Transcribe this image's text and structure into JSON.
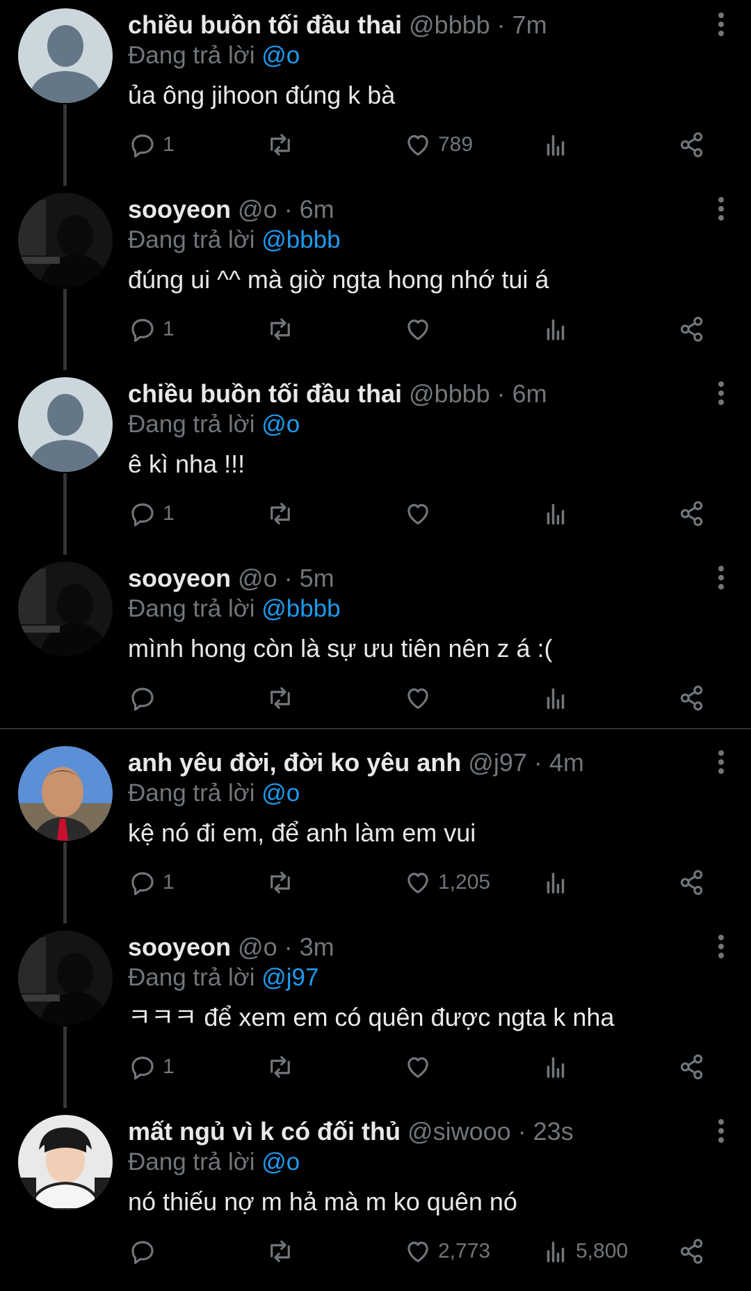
{
  "colors": {
    "background": "#000000",
    "text": "#e7e9ea",
    "muted": "#71767b",
    "link": "#1d9bf0"
  },
  "icons": {
    "reply": "reply-icon",
    "retweet": "retweet-icon",
    "like": "heart-icon",
    "views": "views-icon",
    "share": "share-icon",
    "more": "more-vertical-icon"
  },
  "tweets": [
    {
      "name": "chiều buồn tối đầu thai",
      "handle": "@bbbb",
      "time": "· 7m",
      "replying_label": "Đang trả lời",
      "replying_to": "@o",
      "text": "ủa ông jihoon đúng k bà",
      "replies": "1",
      "retweets": "",
      "likes": "789",
      "views": "",
      "avatar": "default"
    },
    {
      "name": "sooyeon",
      "handle": "@o",
      "time": "· 6m",
      "replying_label": "Đang trả lời",
      "replying_to": "@bbbb",
      "text": "đúng ui ^^ mà giờ ngta hong nhớ tui á",
      "replies": "1",
      "retweets": "",
      "likes": "",
      "views": "",
      "avatar": "dark"
    },
    {
      "name": "chiều buồn tối đầu thai",
      "handle": "@bbbb",
      "time": "· 6m",
      "replying_label": "Đang trả lời",
      "replying_to": "@o",
      "text": "ê kì nha !!!",
      "replies": "1",
      "retweets": "",
      "likes": "",
      "views": "",
      "avatar": "default"
    },
    {
      "name": "sooyeon",
      "handle": "@o",
      "time": "· 5m",
      "replying_label": "Đang trả lời",
      "replying_to": "@bbbb",
      "text": "mình hong còn là sự ưu tiên nên z á :(",
      "replies": "",
      "retweets": "",
      "likes": "",
      "views": "",
      "avatar": "dark"
    },
    {
      "name": "anh yêu đời, đời ko yêu anh",
      "handle": "@j97",
      "time": "· 4m",
      "replying_label": "Đang trả lời",
      "replying_to": "@o",
      "text": "kệ nó đi em, để anh làm em vui",
      "replies": "1",
      "retweets": "",
      "likes": "1,205",
      "views": "",
      "avatar": "man"
    },
    {
      "name": "sooyeon",
      "handle": "@o",
      "time": "· 3m",
      "replying_label": "Đang trả lời",
      "replying_to": "@j97",
      "text": "ㅋㅋㅋ để xem em có quên được ngta k nha",
      "replies": "1",
      "retweets": "",
      "likes": "",
      "views": "",
      "avatar": "dark"
    },
    {
      "name": "mất ngủ vì k có đối thủ",
      "handle": "@siwooo",
      "time": "· 23s",
      "replying_label": "Đang trả lời",
      "replying_to": "@o",
      "text": "nó thiếu nợ m hả mà m ko quên nó",
      "replies": "",
      "retweets": "",
      "likes": "2,773",
      "views": "5,800",
      "avatar": "boy"
    }
  ]
}
